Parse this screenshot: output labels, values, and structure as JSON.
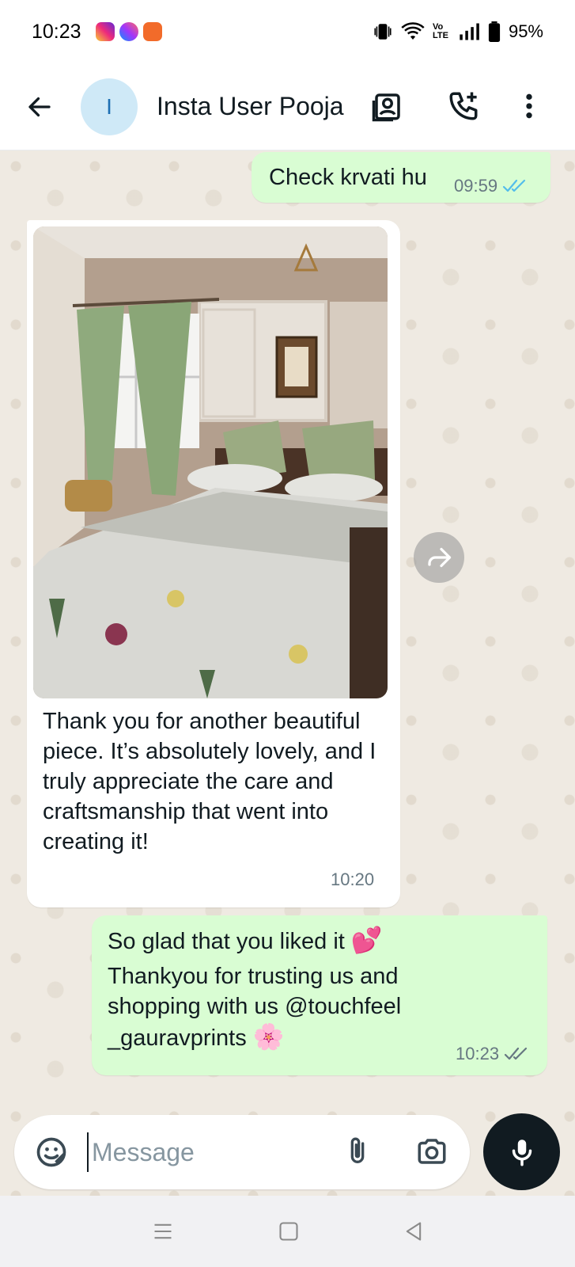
{
  "status_bar": {
    "time": "10:23",
    "notification_icons": [
      {
        "name": "instagram-icon",
        "color": "#dd2a7b"
      },
      {
        "name": "messenger-icon",
        "color": "#7b5cff"
      },
      {
        "name": "app-notification-icon",
        "color": "#f26b2a"
      }
    ],
    "network_label": "Vo LTE",
    "battery": "95%"
  },
  "header": {
    "avatar_initial": "I",
    "contact_name": "Insta User Pooja",
    "icons": [
      "back-arrow-icon",
      "contact-card-icon",
      "add-call-icon",
      "more-vert-icon"
    ]
  },
  "messages": [
    {
      "id": "m1",
      "direction": "outgoing",
      "text": "Check krvati hu",
      "time": "09:59",
      "status": "read",
      "tick_color": "#53bdeb"
    },
    {
      "id": "m2",
      "direction": "incoming",
      "has_image": true,
      "text": "Thank you for another beautiful piece. It’s absolutely lovely, and I truly appreciate the care and craftsmanship that went into creating it!",
      "time": "10:20"
    },
    {
      "id": "m3",
      "direction": "outgoing",
      "line1": "So glad that you liked it",
      "line1_emoji": "💕",
      "line2": "Thankyou for trusting us and shopping with us @touchfeel _gauravprints",
      "line2_emoji": "🌸",
      "time": "10:23",
      "status": "delivered",
      "tick_color": "#667781"
    }
  ],
  "composer": {
    "placeholder": "Message",
    "icons": [
      "sticker-icon",
      "attach-icon",
      "camera-icon",
      "mic-icon"
    ]
  },
  "nav_bar": {
    "icons": [
      "menu-icon",
      "home-icon",
      "back-icon"
    ]
  },
  "colors": {
    "outgoing_bubble": "#d9fdd3",
    "incoming_bubble": "#ffffff",
    "chat_background": "#efeae2",
    "read_tick": "#53bdeb",
    "mic_button": "#111b21"
  }
}
